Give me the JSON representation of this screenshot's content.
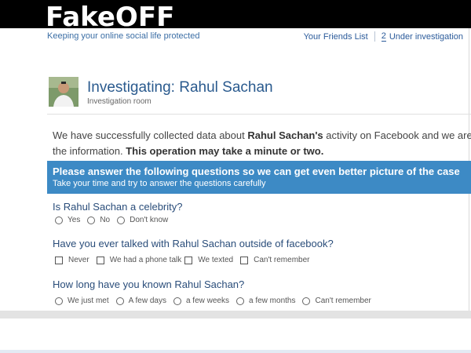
{
  "header": {
    "logo": "FakeOFF",
    "tagline": "Keeping your online social life protected",
    "links": {
      "friends_list": "Your Friends List",
      "investigation_count": "2",
      "under_investigation": "Under investigation"
    }
  },
  "investigation": {
    "title": "Investigating: Rahul Sachan",
    "subtitle": "Investigation room"
  },
  "intro": {
    "part1": "We have successfully collected data about ",
    "name": "Rahul Sachan's",
    "part2": " activity on Facebook and we are",
    "part3": "the information. ",
    "emphasis": "This operation may take a minute or two."
  },
  "questions_panel": {
    "heading": "Please answer the following questions so we can get even better picture of the case",
    "subheading": "Take your time and try to answer the questions carefully"
  },
  "questions": [
    {
      "text": "Is Rahul Sachan a celebrity?",
      "type": "radio",
      "options": [
        "Yes",
        "No",
        "Don't know"
      ]
    },
    {
      "text": "Have you ever talked with Rahul Sachan outside of facebook?",
      "type": "checkbox",
      "options": [
        "Never",
        "We had a phone talk",
        "We texted",
        "Can't remember"
      ]
    },
    {
      "text": "How long have you known Rahul Sachan?",
      "type": "radio",
      "options": [
        "We just met",
        "A few days",
        "a few weeks",
        "a few months",
        "Can't remember"
      ]
    }
  ],
  "colors": {
    "header_bg": "#000000",
    "panel_bg": "#3d8ac5",
    "title_color": "#2a5a8e",
    "question_color": "#2a4d7a"
  }
}
